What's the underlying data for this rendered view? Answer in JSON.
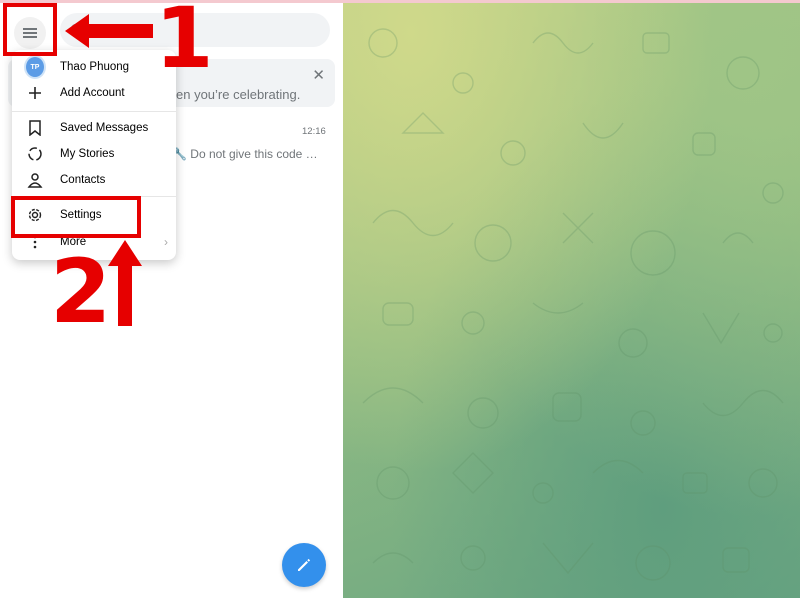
{
  "colors": {
    "accent": "#3390ec",
    "annotation": "#e60000"
  },
  "toolbar": {
    "menu_icon": "hamburger-icon",
    "search_icon": "search-icon"
  },
  "banner": {
    "text": "en you’re celebrating.",
    "close_icon": "close-icon"
  },
  "chat": {
    "time": "12:16",
    "preview": "🔧 Do not give this code …"
  },
  "menu": {
    "account": {
      "avatar": "TP",
      "name": "Thao Phuong"
    },
    "items": [
      {
        "label": "Add Account",
        "icon": "plus-icon"
      },
      {
        "label": "Saved Messages",
        "icon": "bookmark-icon"
      },
      {
        "label": "My Stories",
        "icon": "stories-icon"
      },
      {
        "label": "Contacts",
        "icon": "user-icon"
      },
      {
        "label": "Settings",
        "icon": "gear-icon"
      },
      {
        "label": "More",
        "icon": "more-icon"
      }
    ]
  },
  "compose_icon": "pencil-icon",
  "annotations": {
    "step1": "1",
    "step2": "2"
  }
}
